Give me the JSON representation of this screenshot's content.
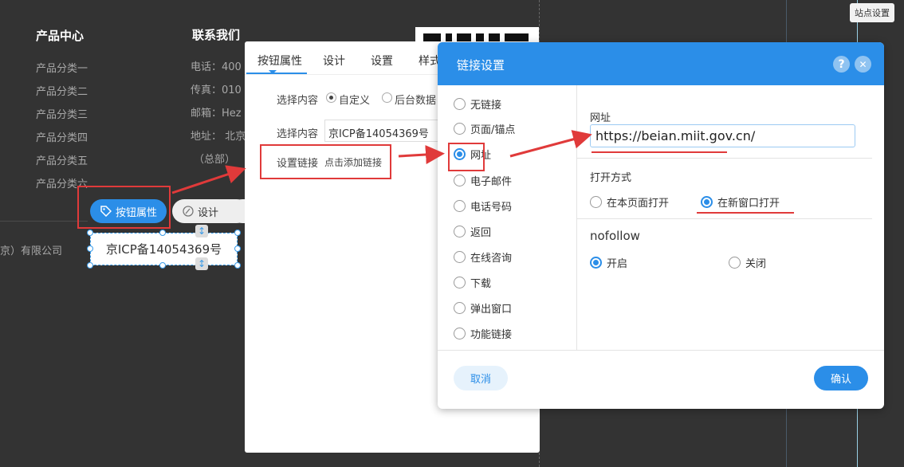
{
  "site_settings_label": "站点设置",
  "site": {
    "products_title": "产品中心",
    "products": [
      "产品分类一",
      "产品分类二",
      "产品分类三",
      "产品分类四",
      "产品分类五",
      "产品分类六"
    ],
    "contact_title": "联系我们",
    "contact": [
      "电话：400",
      "传真：010",
      "邮箱：Hez",
      "地址： 北京",
      "（总部）"
    ],
    "company_fragment": "京）有限公司",
    "icp_text": "京ICP备14054369号"
  },
  "toolbar": {
    "button_props": "按钮属性",
    "design": "设计"
  },
  "panel": {
    "tabs": [
      "按钮属性",
      "设计",
      "设置",
      "样式"
    ],
    "select_content_label": "选择内容",
    "option_custom": "自定义",
    "option_backend": "后台数据",
    "select_content_label2": "选择内容",
    "select_content_value": "京ICP备14054369号",
    "set_link_label": "设置链接",
    "set_link_action": "点击添加链接"
  },
  "dialog": {
    "title": "链接设置",
    "help_symbol": "?",
    "close_symbol": "✕",
    "link_types": [
      "无链接",
      "页面/锚点",
      "网址",
      "电子邮件",
      "电话号码",
      "返回",
      "在线咨询",
      "下载",
      "弹出窗口",
      "功能链接"
    ],
    "selected_link_type": "网址",
    "url_label": "网址",
    "url_value": "https://beian.miit.gov.cn/",
    "open_mode_label": "打开方式",
    "open_current": "在本页面打开",
    "open_new": "在新窗口打开",
    "nofollow_label": "nofollow",
    "nofollow_on": "开启",
    "nofollow_off": "关闭",
    "cancel": "取消",
    "confirm": "确认"
  },
  "colors": {
    "background": "#333333",
    "primary": "#2b8ee8",
    "annotation_red": "#e03a3a"
  },
  "icons": {
    "tag": "tag-icon",
    "design": "palette-icon",
    "help": "question-icon",
    "close": "close-icon"
  }
}
